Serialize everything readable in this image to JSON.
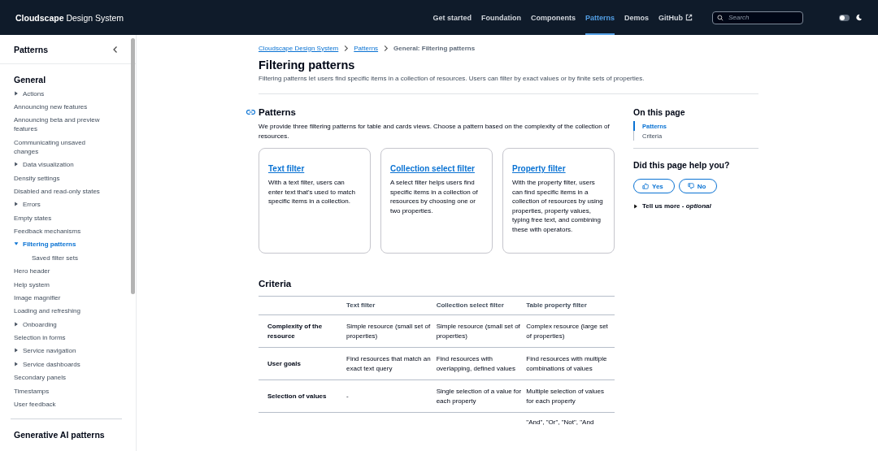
{
  "header": {
    "logo_bold": "Cloudscape",
    "logo_rest": "Design System",
    "nav": [
      {
        "label": "Get started",
        "selected": false
      },
      {
        "label": "Foundation",
        "selected": false
      },
      {
        "label": "Components",
        "selected": false
      },
      {
        "label": "Patterns",
        "selected": true
      },
      {
        "label": "Demos",
        "selected": false
      },
      {
        "label": "GitHub",
        "selected": false,
        "external": true
      }
    ],
    "search": {
      "placeholder": "Search"
    },
    "dark_mode": false
  },
  "sidebar": {
    "title": "Patterns",
    "section": "General",
    "items": [
      {
        "label": "Actions",
        "expanded": false,
        "selected": false
      },
      {
        "label": "Announcing new features",
        "selected": false
      },
      {
        "label": "Announcing beta and preview features",
        "selected": false
      },
      {
        "label": "Communicating unsaved changes",
        "selected": false
      },
      {
        "label": "Data visualization",
        "expanded": false,
        "selected": false
      },
      {
        "label": "Density settings",
        "selected": false
      },
      {
        "label": "Disabled and read-only states",
        "selected": false
      },
      {
        "label": "Errors",
        "expanded": false,
        "selected": false
      },
      {
        "label": "Empty states",
        "selected": false
      },
      {
        "label": "Feedback mechanisms",
        "selected": false
      },
      {
        "label": "Filtering patterns",
        "expanded": true,
        "selected": true,
        "children": [
          {
            "label": "Saved filter sets",
            "selected": false
          }
        ]
      },
      {
        "label": "Hero header",
        "selected": false
      },
      {
        "label": "Help system",
        "selected": false
      },
      {
        "label": "Image magnifier",
        "selected": false
      },
      {
        "label": "Loading and refreshing",
        "selected": false
      },
      {
        "label": "Onboarding",
        "expanded": false,
        "selected": false
      },
      {
        "label": "Selection in forms",
        "selected": false
      },
      {
        "label": "Service navigation",
        "expanded": false,
        "selected": false
      },
      {
        "label": "Service dashboards",
        "expanded": false,
        "selected": false
      },
      {
        "label": "Secondary panels",
        "selected": false
      },
      {
        "label": "Timestamps",
        "selected": false
      },
      {
        "label": "User feedback",
        "selected": false
      }
    ],
    "section_2": "Generative AI patterns"
  },
  "breadcrumbs": [
    "Cloudscape Design System",
    "Patterns",
    "General: Filtering patterns"
  ],
  "title": "Filtering patterns",
  "description": "Filtering patterns let users find specific items in a collection of resources. Users can filter by exact values or by finite sets of properties.",
  "patterns": {
    "heading": "Patterns",
    "intro": "We provide three filtering patterns for table and cards views. Choose a pattern based on the complexity of the collection of resources.",
    "cards": [
      {
        "title": "Text filter",
        "text": "With a text filter, users can enter text that's used to match specific items in a collection."
      },
      {
        "title": "Collection select filter",
        "text": "A select filter helps users find specific items in a collection of resources by choosing one or two properties."
      },
      {
        "title": "Property filter",
        "text": "With the property filter, users can find specific items in a collection of resources by using properties, property values, typing free text, and combining these with operators."
      }
    ]
  },
  "criteria": {
    "heading": "Criteria",
    "columns": [
      "",
      "Text filter",
      "Collection select filter",
      "Table property filter"
    ],
    "rows": [
      [
        "Complexity of the resource",
        "Simple resource (small set of properties)",
        "Simple resource (small set of properties)",
        "Complex resource (large set of properties)"
      ],
      [
        "User goals",
        "Find resources that match an exact text query",
        "Find resources with overlapping, defined values",
        "Find resources with multiple combinations of values"
      ],
      [
        "Selection of values",
        "-",
        "Single selection of a value for each property",
        "Multiple selection of values for each property"
      ],
      [
        "",
        "",
        "",
        "\"And\", \"Or\", \"Not\", \"And"
      ]
    ]
  },
  "on_this_page": {
    "title": "On this page",
    "links": [
      {
        "label": "Patterns",
        "selected": true
      },
      {
        "label": "Criteria",
        "selected": false
      }
    ]
  },
  "feedback": {
    "title": "Did this page help you?",
    "yes": "Yes",
    "no": "No",
    "more": "Tell us more - ",
    "optional": "optional"
  }
}
